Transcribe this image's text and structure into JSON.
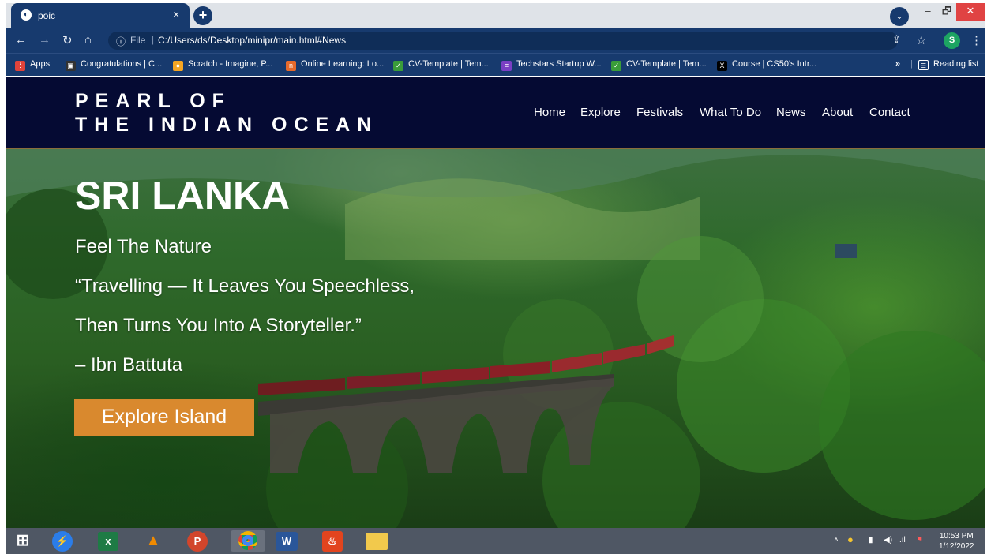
{
  "browser": {
    "tab_title": "poic",
    "tab_close": "×",
    "new_tab": "+",
    "url_prefix": "File",
    "url": "C:/Users/ds/Desktop/minipr/main.html#News",
    "profile_initial": "S",
    "reading_list": "Reading list",
    "bookmarks_overflow": "»",
    "window_controls": {
      "minimize": "–",
      "maximize": "🗗",
      "close": "✕"
    }
  },
  "bookmarks": [
    {
      "label": "Apps",
      "icon": "apps-grid-icon",
      "color": "#e0433b"
    },
    {
      "label": "Congratulations | C...",
      "icon": "bookmark-site-icon",
      "color": "#333333"
    },
    {
      "label": "Scratch - Imagine, P...",
      "icon": "scratch-icon",
      "color": "#f5a623"
    },
    {
      "label": "Online Learning: Lo...",
      "icon": "learning-icon",
      "color": "#e66a2c"
    },
    {
      "label": "CV-Template | Tem...",
      "icon": "cv-icon",
      "color": "#3a9d3a"
    },
    {
      "label": "Techstars Startup W...",
      "icon": "list-icon",
      "color": "#7a3fc4"
    },
    {
      "label": "CV-Template | Tem...",
      "icon": "cv-icon",
      "color": "#3a9d3a"
    },
    {
      "label": "Course | CS50's Intr...",
      "icon": "x-logo-icon",
      "color": "#000000"
    }
  ],
  "site": {
    "logo_line1": "PEARL OF",
    "logo_line2": "THE INDIAN OCEAN",
    "nav": [
      "Home",
      "Explore",
      "Festivals",
      "What To Do",
      "News",
      "About",
      "Contact"
    ]
  },
  "hero": {
    "title": "SRI LANKA",
    "line1": "Feel The Nature",
    "line2": "“Travelling — It Leaves You Speechless,",
    "line3": "Then Turns You Into A Storyteller.”",
    "line4": "– Ibn Battuta",
    "cta": "Explore Island"
  },
  "taskbar": {
    "apps": [
      {
        "name": "windows-start-icon",
        "color": "#ffffff"
      },
      {
        "name": "messenger-icon",
        "color": "#2b7de9"
      },
      {
        "name": "excel-icon",
        "color": "#1e7b45"
      },
      {
        "name": "vlc-icon",
        "color": "#f08a00"
      },
      {
        "name": "powerpoint-icon",
        "color": "#d2452b"
      },
      {
        "name": "chrome-icon",
        "color": "#db4437"
      },
      {
        "name": "word-icon",
        "color": "#2a5699"
      },
      {
        "name": "acrobat-icon",
        "color": "#e2441e"
      },
      {
        "name": "file-explorer-icon",
        "color": "#f2c94c"
      }
    ],
    "time": "10:53 PM",
    "date": "1/12/2022"
  },
  "colors": {
    "header_bg": "#050a33",
    "cta_bg": "#d9892e",
    "browser_accent": "#173a6e"
  }
}
